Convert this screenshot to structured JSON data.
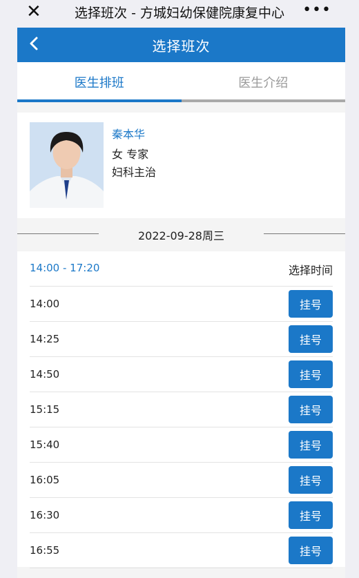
{
  "window": {
    "title": "选择班次 - 方城妇幼保健院康复中心",
    "close_icon": "close-icon",
    "more_icon": "more-icon",
    "more_label": "•••"
  },
  "nav": {
    "title": "选择班次",
    "back_icon": "chevron-left-icon"
  },
  "tabs": [
    {
      "label": "医生排班",
      "active": true
    },
    {
      "label": "医生介绍",
      "active": false
    }
  ],
  "doctor": {
    "name": "秦本华",
    "gender_title": "女 专家",
    "department": "妇科主治"
  },
  "date": "2022-09-28周三",
  "schedule": {
    "range": "14:00 - 17:20",
    "hint": "选择时间",
    "button_label": "挂号",
    "slots": [
      "14:00",
      "14:25",
      "14:50",
      "15:15",
      "15:40",
      "16:05",
      "16:30",
      "16:55"
    ]
  },
  "colors": {
    "accent": "#1b78c8",
    "background": "#efeff4"
  }
}
